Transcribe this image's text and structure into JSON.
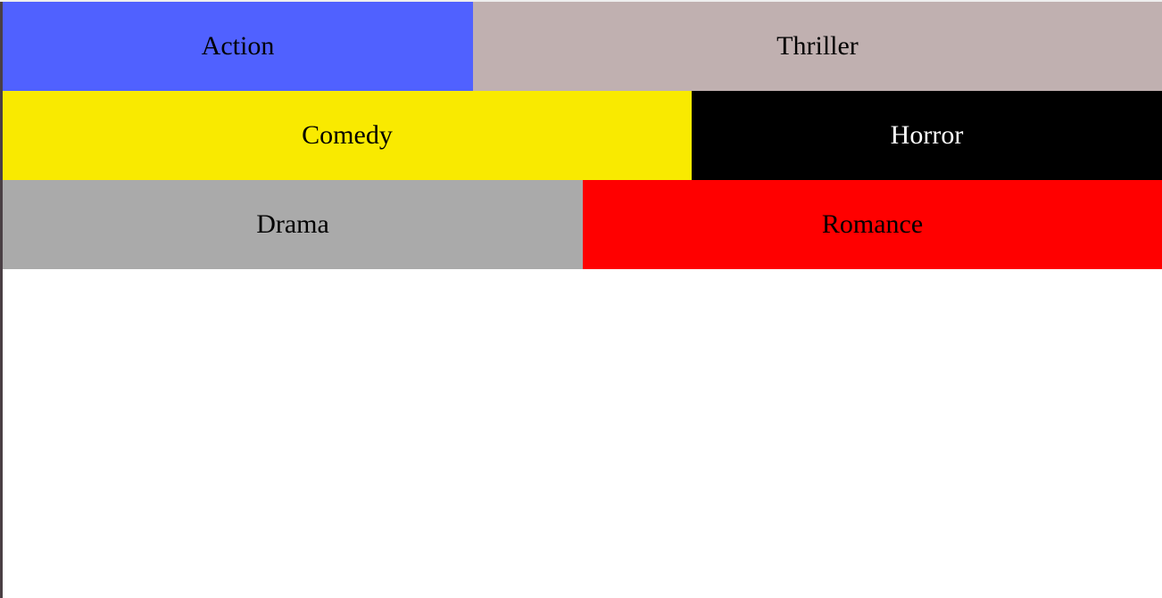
{
  "genres": {
    "row1": [
      {
        "label": "Action",
        "color": "#5061ff",
        "text_color": "#000000"
      },
      {
        "label": "Thriller",
        "color": "#c0b0b0",
        "text_color": "#000000"
      }
    ],
    "row2": [
      {
        "label": "Comedy",
        "color": "#f9ea00",
        "text_color": "#000000"
      },
      {
        "label": "Horror",
        "color": "#000000",
        "text_color": "#ffffff"
      }
    ],
    "row3": [
      {
        "label": "Drama",
        "color": "#aaaaaa",
        "text_color": "#000000"
      },
      {
        "label": "Romance",
        "color": "#ff0000",
        "text_color": "#000000"
      }
    ]
  }
}
